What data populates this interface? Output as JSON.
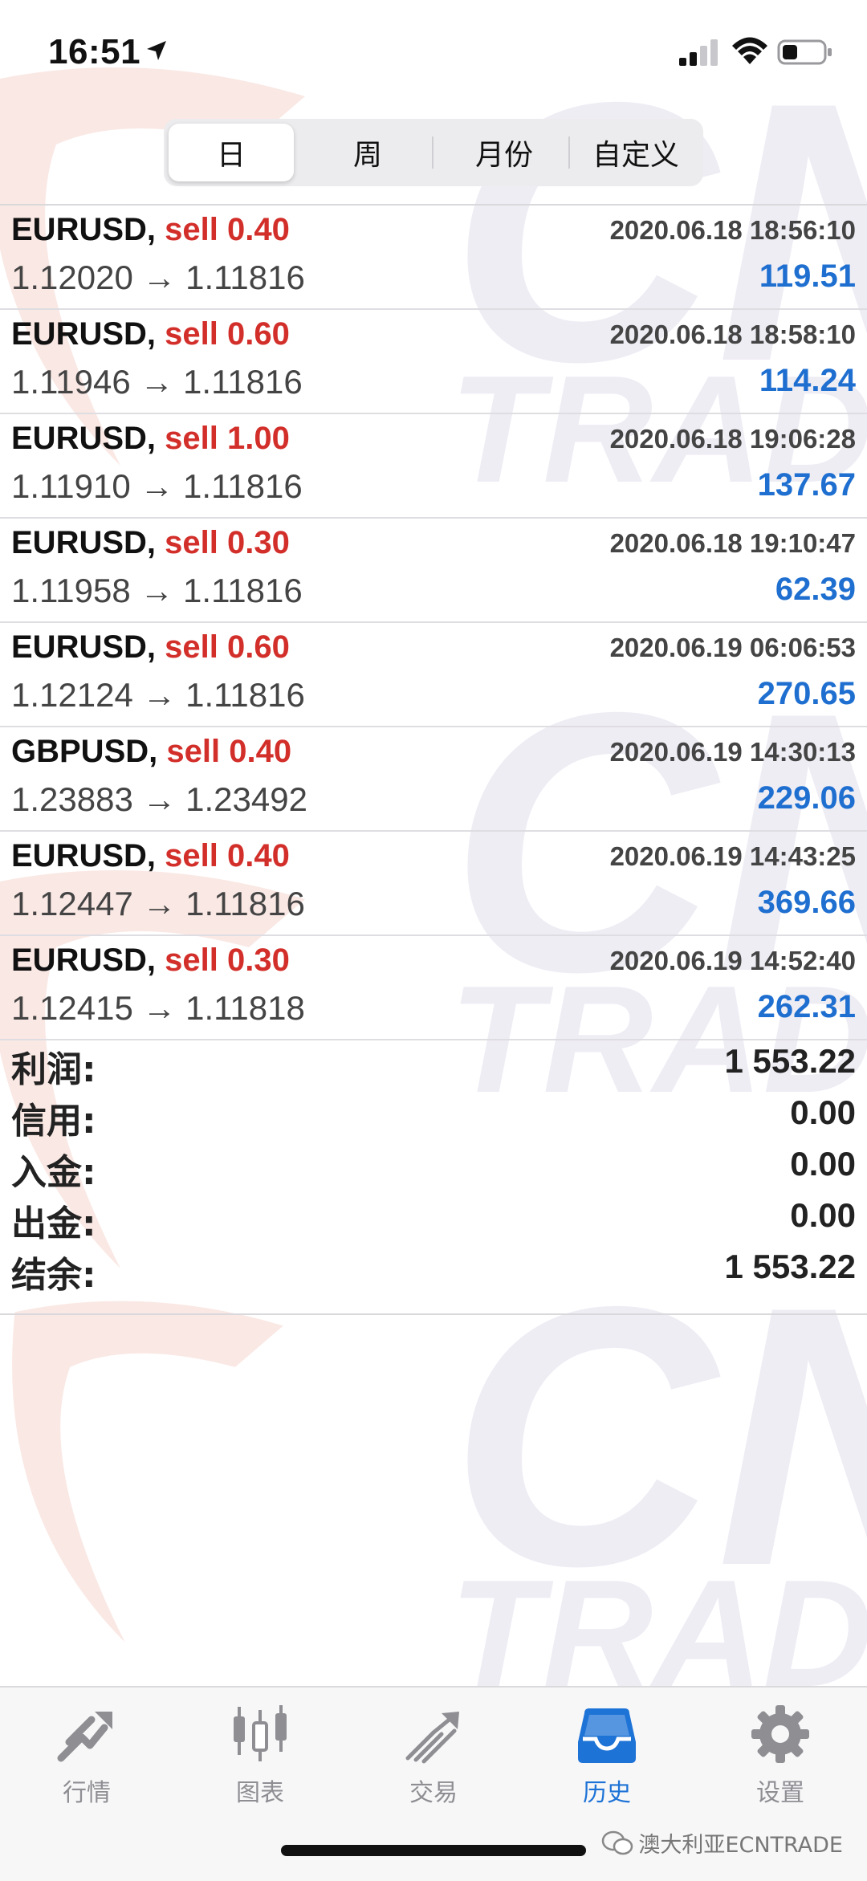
{
  "status_bar": {
    "time": "16:51"
  },
  "segments": [
    {
      "label": "日",
      "active": true
    },
    {
      "label": "周",
      "active": false
    },
    {
      "label": "月份",
      "active": false
    },
    {
      "label": "自定义",
      "active": false
    }
  ],
  "trades": [
    {
      "symbol": "EURUSD,",
      "side": "sell",
      "volume": "0.40",
      "time": "2020.06.18 18:56:10",
      "prices": "1.12020 → 1.11816",
      "profit": "119.51"
    },
    {
      "symbol": "EURUSD,",
      "side": "sell",
      "volume": "0.60",
      "time": "2020.06.18 18:58:10",
      "prices": "1.11946 → 1.11816",
      "profit": "114.24"
    },
    {
      "symbol": "EURUSD,",
      "side": "sell",
      "volume": "1.00",
      "time": "2020.06.18 19:06:28",
      "prices": "1.11910 → 1.11816",
      "profit": "137.67"
    },
    {
      "symbol": "EURUSD,",
      "side": "sell",
      "volume": "0.30",
      "time": "2020.06.18 19:10:47",
      "prices": "1.11958 → 1.11816",
      "profit": "62.39"
    },
    {
      "symbol": "EURUSD,",
      "side": "sell",
      "volume": "0.60",
      "time": "2020.06.19 06:06:53",
      "prices": "1.12124 → 1.11816",
      "profit": "270.65"
    },
    {
      "symbol": "GBPUSD,",
      "side": "sell",
      "volume": "0.40",
      "time": "2020.06.19 14:30:13",
      "prices": "1.23883 → 1.23492",
      "profit": "229.06"
    },
    {
      "symbol": "EURUSD,",
      "side": "sell",
      "volume": "0.40",
      "time": "2020.06.19 14:43:25",
      "prices": "1.12447 → 1.11816",
      "profit": "369.66"
    },
    {
      "symbol": "EURUSD,",
      "side": "sell",
      "volume": "0.30",
      "time": "2020.06.19 14:52:40",
      "prices": "1.12415 → 1.11818",
      "profit": "262.31"
    }
  ],
  "summary": [
    {
      "label": "利润:",
      "value": "1 553.22"
    },
    {
      "label": "信用:",
      "value": "0.00"
    },
    {
      "label": "入金:",
      "value": "0.00"
    },
    {
      "label": "出金:",
      "value": "0.00"
    },
    {
      "label": "结余:",
      "value": "1 553.22"
    }
  ],
  "tabs": [
    {
      "label": "行情",
      "icon": "quotes-icon",
      "active": false
    },
    {
      "label": "图表",
      "icon": "chart-icon",
      "active": false
    },
    {
      "label": "交易",
      "icon": "trade-icon",
      "active": false
    },
    {
      "label": "历史",
      "icon": "history-icon",
      "active": true
    },
    {
      "label": "设置",
      "icon": "settings-icon",
      "active": false
    }
  ],
  "watermark": {
    "text_cn": "CN",
    "text_trade": "TRADE"
  },
  "wechat_label": "澳大利亚ECNTRADE",
  "colors": {
    "sell": "#d32f2a",
    "profit": "#1f6fd0",
    "active_tab": "#1e73d6",
    "inactive_tab": "#8e8e93"
  }
}
